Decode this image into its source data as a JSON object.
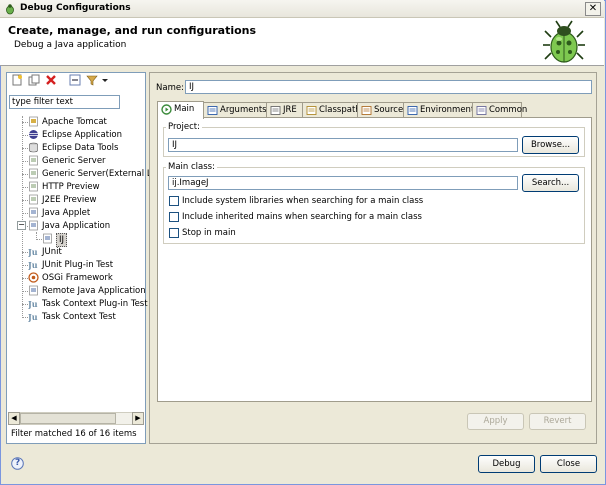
{
  "window": {
    "title": "Debug Configurations",
    "close": "✕"
  },
  "banner": {
    "title": "Create, manage, and run configurations",
    "subtitle": "Debug a Java application"
  },
  "left_pane": {
    "filter_placeholder": "type filter text",
    "filter_value": "type filter text",
    "tree": [
      {
        "label": "Apache Tomcat",
        "icon": "tomcat-icon",
        "color": "#d7b046"
      },
      {
        "label": "Eclipse Application",
        "icon": "eclipse-icon",
        "color": "#3d3d8f"
      },
      {
        "label": "Eclipse Data Tools",
        "icon": "database-icon",
        "color": "#8a8a8a"
      },
      {
        "label": "Generic Server",
        "icon": "server-icon",
        "color": "#7a9a6a"
      },
      {
        "label": "Generic Server(External La",
        "icon": "server-icon",
        "color": "#7a9a6a"
      },
      {
        "label": "HTTP Preview",
        "icon": "server-icon",
        "color": "#7a9a6a"
      },
      {
        "label": "J2EE Preview",
        "icon": "server-icon",
        "color": "#7a9a6a"
      },
      {
        "label": "Java Applet",
        "icon": "applet-icon",
        "color": "#4a6aa5"
      },
      {
        "label": "Java Application",
        "icon": "java-app-icon",
        "color": "#4a6aa5"
      },
      {
        "label": "IJ",
        "icon": "java-config-icon",
        "color": "#4a6aa5"
      },
      {
        "label": "JUnit",
        "icon": "junit-icon",
        "color": "#6d8ea8"
      },
      {
        "label": "JUnit Plug-in Test",
        "icon": "junit-icon",
        "color": "#6d8ea8"
      },
      {
        "label": "OSGi Framework",
        "icon": "osgi-icon",
        "color": "#c05a1a"
      },
      {
        "label": "Remote Java Application",
        "icon": "remote-icon",
        "color": "#4a6aa5"
      },
      {
        "label": "Task Context Plug-in Test",
        "icon": "junit-icon",
        "color": "#6d8ea8"
      },
      {
        "label": "Task Context Test",
        "icon": "junit-icon",
        "color": "#6d8ea8"
      }
    ],
    "filter_status": "Filter matched 16 of 16 items",
    "expand_minus": "−"
  },
  "config": {
    "name_label": "Name:",
    "name_value": "IJ",
    "tabs": [
      {
        "label": "Main",
        "icon": "main-tab-icon"
      },
      {
        "label": "Arguments",
        "icon": "arguments-tab-icon"
      },
      {
        "label": "JRE",
        "icon": "jre-tab-icon"
      },
      {
        "label": "Classpath",
        "icon": "classpath-tab-icon"
      },
      {
        "label": "Source",
        "icon": "source-tab-icon"
      },
      {
        "label": "Environment",
        "icon": "environment-tab-icon"
      },
      {
        "label": "Common",
        "icon": "common-tab-icon"
      }
    ],
    "project_label": "Project:",
    "project_value": "IJ",
    "browse_button": "Browse...",
    "main_class_label": "Main class:",
    "main_class_value": "ij.ImageJ",
    "search_button": "Search...",
    "checkboxes": [
      {
        "label": "Include system libraries when searching for a main class",
        "checked": false
      },
      {
        "label": "Include inherited mains when searching for a main class",
        "checked": false
      },
      {
        "label": "Stop in main",
        "checked": false
      }
    ],
    "apply_button": "Apply",
    "revert_button": "Revert"
  },
  "footer": {
    "help": "?",
    "debug_button": "Debug",
    "close_button": "Close"
  },
  "scroll": {
    "left_arrow": "◀",
    "right_arrow": "▶"
  }
}
